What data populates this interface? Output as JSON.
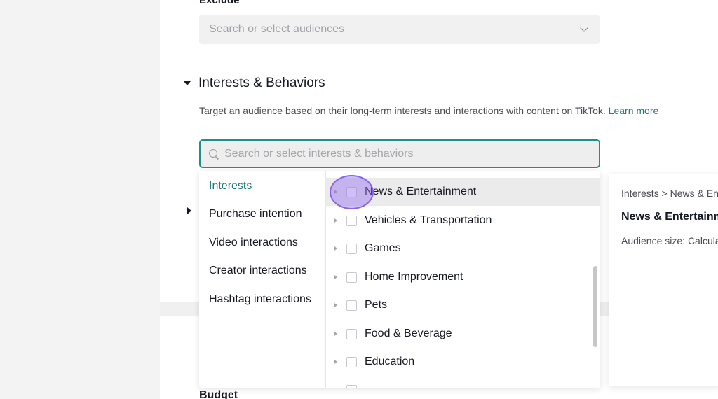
{
  "exclude": {
    "label": "Exclude",
    "placeholder": "Search or select audiences"
  },
  "interests_section": {
    "title": "Interests & Behaviors",
    "description": "Target an audience based on their long-term interests and interactions with content on TikTok.",
    "learn_more": "Learn more",
    "search_placeholder": "Search or select interests & behaviors"
  },
  "categories": [
    {
      "label": "Interests",
      "active": true
    },
    {
      "label": "Purchase intention",
      "active": false
    },
    {
      "label": "Video interactions",
      "active": false
    },
    {
      "label": "Creator interactions",
      "active": false
    },
    {
      "label": "Hashtag interactions",
      "active": false
    }
  ],
  "options": [
    {
      "label": "News & Entertainment",
      "hover": true
    },
    {
      "label": "Vehicles & Transportation"
    },
    {
      "label": "Games"
    },
    {
      "label": "Home Improvement"
    },
    {
      "label": "Pets"
    },
    {
      "label": "Food & Beverage"
    },
    {
      "label": "Education"
    }
  ],
  "detail": {
    "breadcrumb": "Interests > News & Entertainment",
    "title": "News & Entertainment",
    "audience_size": "Audience size: Calculating"
  },
  "budget_label": "Budget",
  "colors": {
    "accent": "#1f7a78",
    "focus_border": "#1f8f8a",
    "cursor": "#8a63e6"
  }
}
